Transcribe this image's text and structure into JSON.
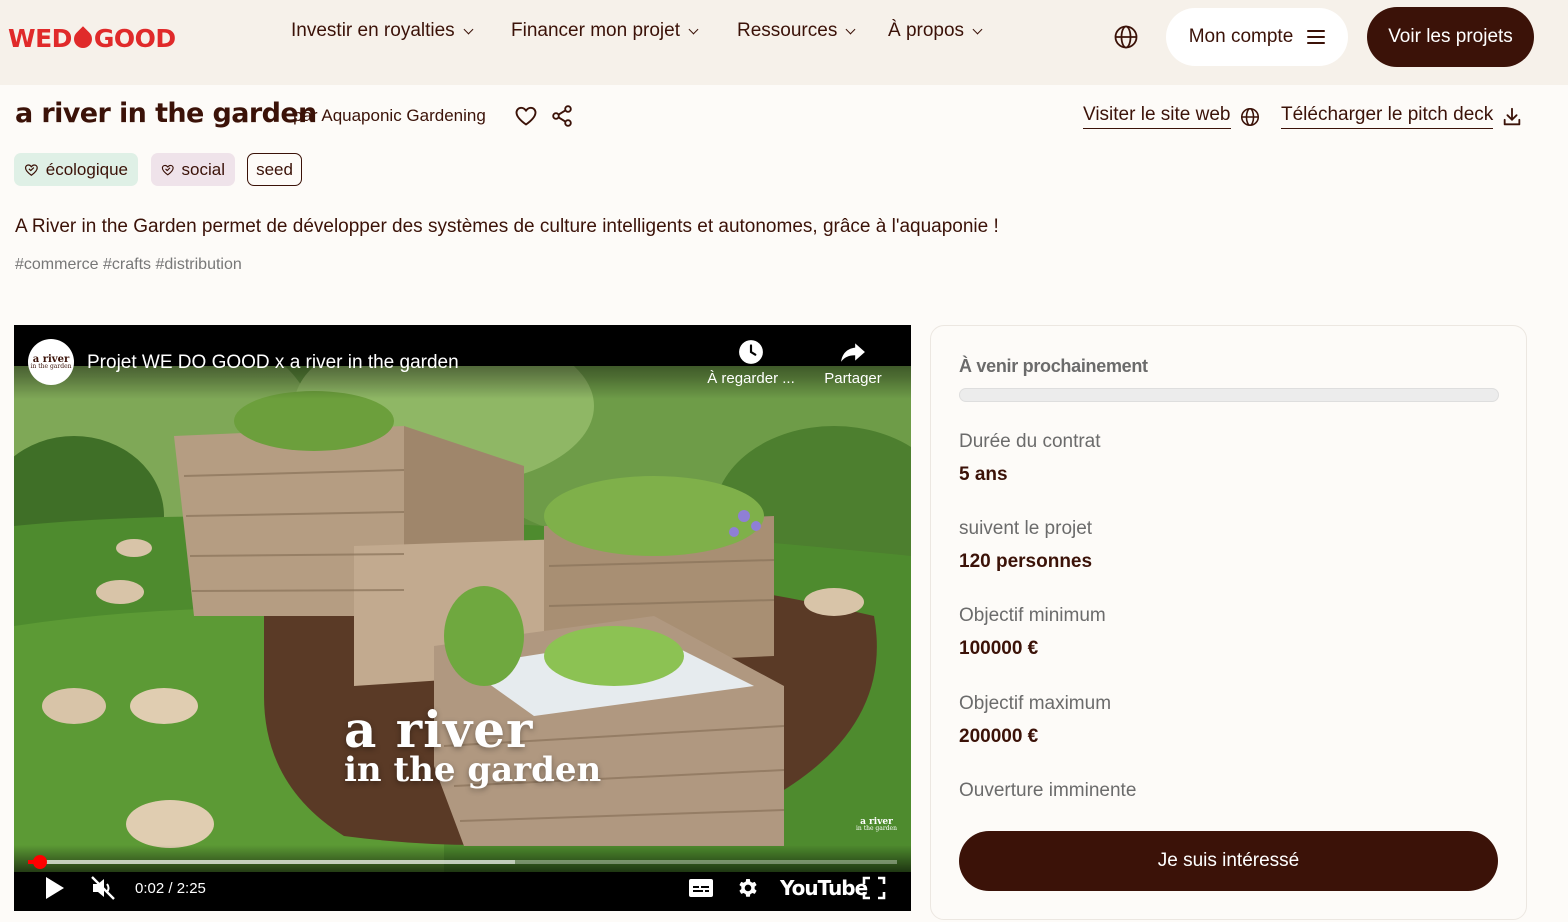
{
  "nav": {
    "logo": {
      "part1": "WED",
      "part2": "GOOD"
    },
    "menu": [
      {
        "label": "Investir en royalties"
      },
      {
        "label": "Financer mon projet"
      },
      {
        "label": "Ressources"
      },
      {
        "label": "À propos"
      }
    ],
    "account_label": "Mon compte",
    "projects_label": "Voir les projets"
  },
  "project": {
    "title": "a river in the garden",
    "byline": "par Aquaponic Gardening",
    "website_label": "Visiter le site web",
    "pitch_label": "Télécharger le pitch deck",
    "tags": [
      "écologique",
      "social",
      "seed"
    ],
    "description": "A River in the Garden permet de développer des systèmes de culture intelligents et autonomes, grâce à l'aquaponie !",
    "hashtags": "#commerce #crafts #distribution"
  },
  "video": {
    "channel_avatar_line1": "a river",
    "channel_avatar_line2": "in the garden",
    "title": "Projet WE DO GOOD x a river in the garden",
    "watch_later_label": "À regarder ...",
    "share_label": "Partager",
    "overlay_line1": "a river",
    "overlay_line2": "in the garden",
    "watermark_line1": "a river",
    "watermark_line2": "in the garden",
    "time": "0:02 / 2:25",
    "progress_fraction": 0.014,
    "buffered_fraction": 0.56,
    "brand": "YouTube",
    "accent_color": "#ff0000"
  },
  "panel": {
    "status": "À venir prochainement",
    "progress_fraction": 0,
    "stats": [
      {
        "label": "Durée du contrat",
        "value": "5 ans"
      },
      {
        "label": "suivent le projet",
        "value": "120 personnes"
      },
      {
        "label": "Objectif minimum",
        "value": "100000 €"
      },
      {
        "label": "Objectif maximum",
        "value": "200000 €"
      }
    ],
    "opening": "Ouverture imminente",
    "cta_label": "Je suis intéressé"
  },
  "colors": {
    "brand_dark": "#3b1208",
    "logo_red": "#e02a2a",
    "nav_bg": "#f6f1ea",
    "eco_tag_bg": "#dff0e6",
    "social_tag_bg": "#efe3ea"
  },
  "icons": [
    "globe-icon",
    "hamburger-icon",
    "heart-icon",
    "share-icon",
    "download-icon",
    "leaf-heart-icon",
    "clock-icon",
    "forward-arrow-icon",
    "play-icon",
    "muted-icon",
    "captions-icon",
    "gear-icon",
    "fullscreen-icon"
  ]
}
